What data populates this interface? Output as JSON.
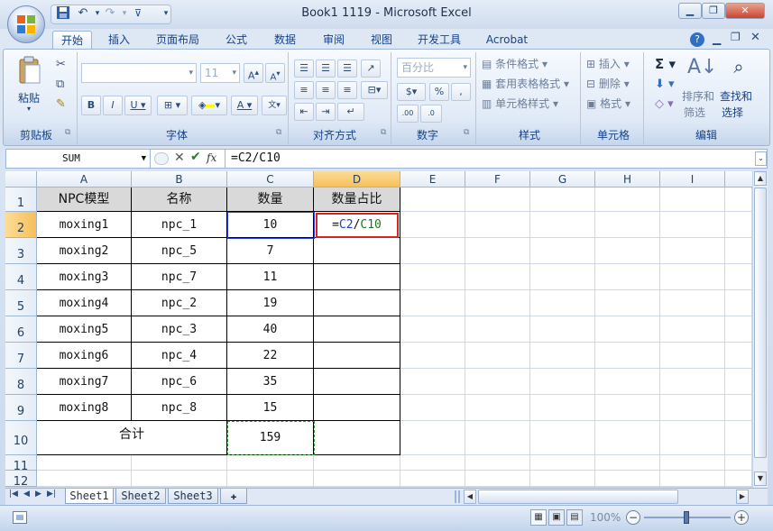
{
  "window": {
    "title": "Book1 1119 - Microsoft Excel"
  },
  "tabs": [
    {
      "label": "开始",
      "active": true
    },
    {
      "label": "插入"
    },
    {
      "label": "页面布局"
    },
    {
      "label": "公式"
    },
    {
      "label": "数据"
    },
    {
      "label": "审阅"
    },
    {
      "label": "视图"
    },
    {
      "label": "开发工具"
    },
    {
      "label": "Acrobat"
    }
  ],
  "ribbon": {
    "groups": {
      "clipboard": "剪贴板",
      "font": "字体",
      "alignment": "对齐方式",
      "number": "数字",
      "styles": "样式",
      "cells": "单元格",
      "editing": "编辑"
    },
    "paste_label": "粘贴",
    "font_size": "11",
    "number_format": "百分比",
    "conditional_format": "条件格式",
    "table_format": "套用表格格式",
    "cell_styles": "单元格样式",
    "insert": "插入",
    "delete": "删除",
    "format": "格式",
    "sort_filter_1": "排序和",
    "sort_filter_2": "筛选",
    "find_select_1": "查找和",
    "find_select_2": "选择"
  },
  "formula_bar": {
    "name_box": "SUM",
    "formula": "=C2/C10",
    "fx": "fx"
  },
  "columns": [
    "A",
    "B",
    "C",
    "D",
    "E",
    "F",
    "G",
    "H",
    "I"
  ],
  "row_numbers": [
    "1",
    "2",
    "3",
    "4",
    "5",
    "6",
    "7",
    "8",
    "9",
    "10",
    "11",
    "12"
  ],
  "table": {
    "headers": [
      "NPC模型",
      "名称",
      "数量",
      "数量占比"
    ],
    "rows": [
      [
        "moxing1",
        "npc_1",
        "10"
      ],
      [
        "moxing2",
        "npc_5",
        "7"
      ],
      [
        "moxing3",
        "npc_7",
        "11"
      ],
      [
        "moxing4",
        "npc_2",
        "19"
      ],
      [
        "moxing5",
        "npc_3",
        "40"
      ],
      [
        "moxing6",
        "npc_4",
        "22"
      ],
      [
        "moxing7",
        "npc_6",
        "35"
      ],
      [
        "moxing8",
        "npc_8",
        "15"
      ]
    ],
    "total_label": "合计",
    "total_value": "159",
    "editing_cell": {
      "prefix": "=",
      "ref1": "C2",
      "slash": "/",
      "ref2": "C10"
    }
  },
  "sheets": [
    "Sheet1",
    "Sheet2",
    "Sheet3"
  ],
  "status": {
    "zoom": "100%"
  }
}
